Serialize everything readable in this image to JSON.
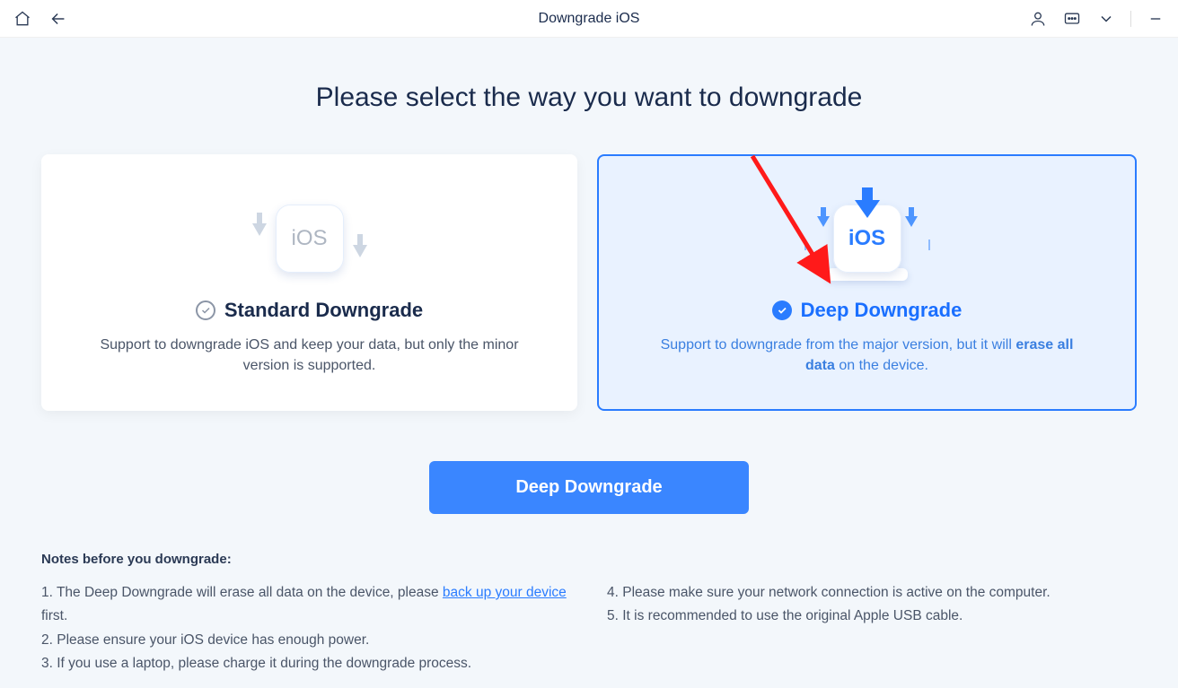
{
  "titlebar": {
    "title": "Downgrade iOS"
  },
  "heading": "Please select the way you want to downgrade",
  "cards": {
    "standard": {
      "ios_label": "iOS",
      "title": "Standard Downgrade",
      "desc": "Support to downgrade iOS and keep your data, but only the minor version is supported."
    },
    "deep": {
      "ios_label": "iOS",
      "title": "Deep Downgrade",
      "desc_pre": "Support to downgrade from the major version, but it will ",
      "desc_bold": "erase all data",
      "desc_post": " on the device."
    }
  },
  "cta": {
    "label": "Deep Downgrade"
  },
  "notes": {
    "title": "Notes before you downgrade:",
    "n1_pre": "1.  The Deep Downgrade will erase all data on the device, please ",
    "n1_link": "back up your device",
    "n1_post": " first.",
    "n2": "2.  Please ensure your iOS device has enough power.",
    "n3": "3.  If you use a laptop, please charge it during the downgrade process.",
    "n4": "4.  Please make sure your network connection is active on the computer.",
    "n5": "5.  It is recommended to use the original Apple USB cable."
  }
}
